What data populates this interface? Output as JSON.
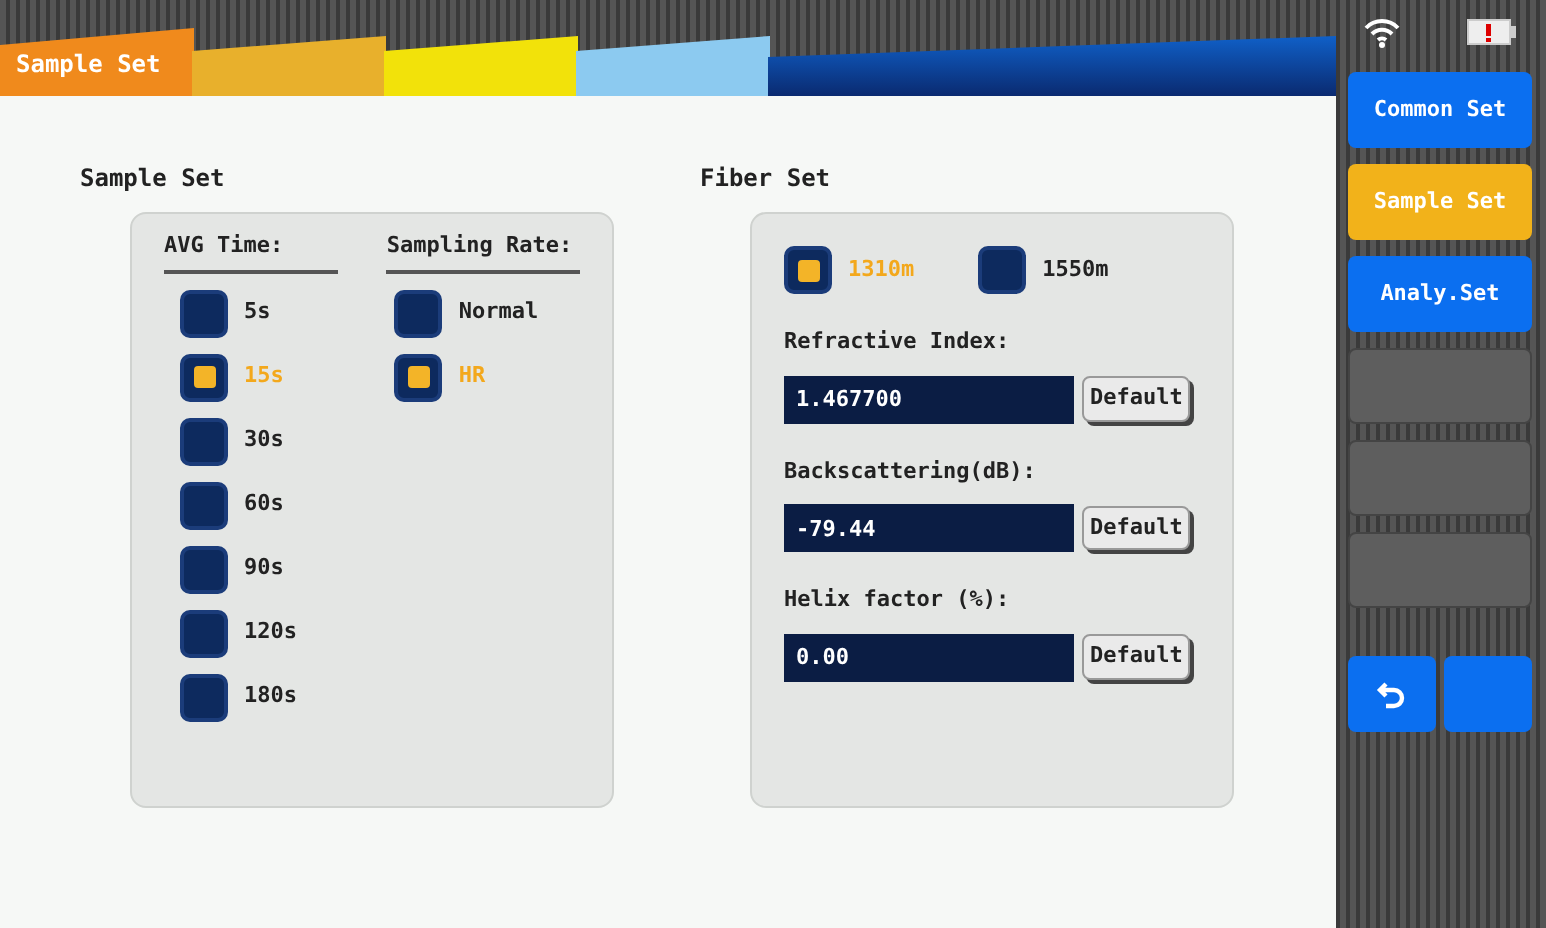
{
  "tabs": [
    {
      "label": "Sample Set",
      "selected": true,
      "color": "#f08a1c"
    },
    {
      "selected": false,
      "color": "#e8b02c"
    },
    {
      "selected": false,
      "color": "#f2e20a"
    },
    {
      "selected": false,
      "color": "#8ccaf0"
    }
  ],
  "sample_set": {
    "title": "Sample Set",
    "avg_time": {
      "heading": "AVG Time:",
      "options": [
        {
          "label": "5s",
          "selected": false
        },
        {
          "label": "15s",
          "selected": true
        },
        {
          "label": "30s",
          "selected": false
        },
        {
          "label": "60s",
          "selected": false
        },
        {
          "label": "90s",
          "selected": false
        },
        {
          "label": "120s",
          "selected": false
        },
        {
          "label": "180s",
          "selected": false
        }
      ]
    },
    "sampling_rate": {
      "heading": "Sampling Rate:",
      "options": [
        {
          "label": "Normal",
          "selected": false
        },
        {
          "label": "HR",
          "selected": true
        }
      ]
    }
  },
  "fiber_set": {
    "title": "Fiber Set",
    "wavelengths": [
      {
        "label": "1310m",
        "selected": true
      },
      {
        "label": "1550m",
        "selected": false
      }
    ],
    "fields": [
      {
        "label": "Refractive Index:",
        "value": "1.467700",
        "button": "Default"
      },
      {
        "label": "Backscattering(dB):",
        "value": "-79.44",
        "button": "Default"
      },
      {
        "label": "Helix factor (%):",
        "value": "0.00",
        "button": "Default"
      }
    ]
  },
  "sidebar": {
    "items": [
      {
        "label": "Common Set",
        "selected": false,
        "disabled": false
      },
      {
        "label": "Sample Set",
        "selected": true,
        "disabled": false
      },
      {
        "label": "Analy.Set",
        "selected": false,
        "disabled": false
      },
      {
        "selected": false,
        "disabled": true
      },
      {
        "selected": false,
        "disabled": true
      },
      {
        "selected": false,
        "disabled": true
      }
    ]
  }
}
